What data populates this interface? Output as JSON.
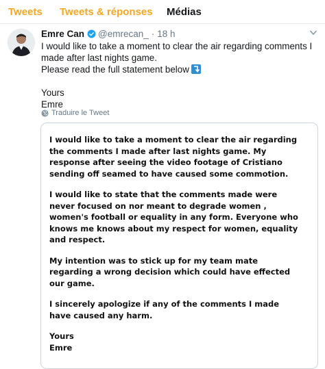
{
  "tabs": [
    {
      "label": "Tweets",
      "active": false
    },
    {
      "label": "Tweets & réponses",
      "active": false
    },
    {
      "label": "Médias",
      "active": true
    }
  ],
  "tweet": {
    "author_name": "Emre Can",
    "verified": true,
    "handle": "@emrecan_",
    "separator": "·",
    "time": "18 h",
    "text_lines": [
      "I would like to take a moment to clear the air regarding comments I made after last nights game.",
      "Please read the full statement below"
    ],
    "signoff": [
      "Yours",
      "Emre"
    ],
    "translate_label": "Traduire le Tweet"
  },
  "statement": {
    "paragraphs": [
      "I would like to take a moment to clear the air regarding the comments I made after last nights game. My response after seeing the video footage of Cristiano sending off seamed to have caused some commotion.",
      "I would like to state that the comments made were never focused on nor meant to degrade women , women's football or equality in any form. Everyone who knows me knows about my respect for women, equality and respect.",
      "My intention was to stick up for my team mate regarding a wrong decision which could have effected our game.",
      "I sincerely apologize if any of the comments I made have caused any harm."
    ],
    "signoff": [
      "Yours",
      "Emre"
    ]
  },
  "colors": {
    "accent": "#f5a623",
    "verified": "#1da1f2",
    "muted": "#657786",
    "text": "#14171a"
  },
  "icons": [
    "verified-badge-icon",
    "caret-down-icon",
    "arrow-emoji-icon",
    "globe-icon"
  ]
}
